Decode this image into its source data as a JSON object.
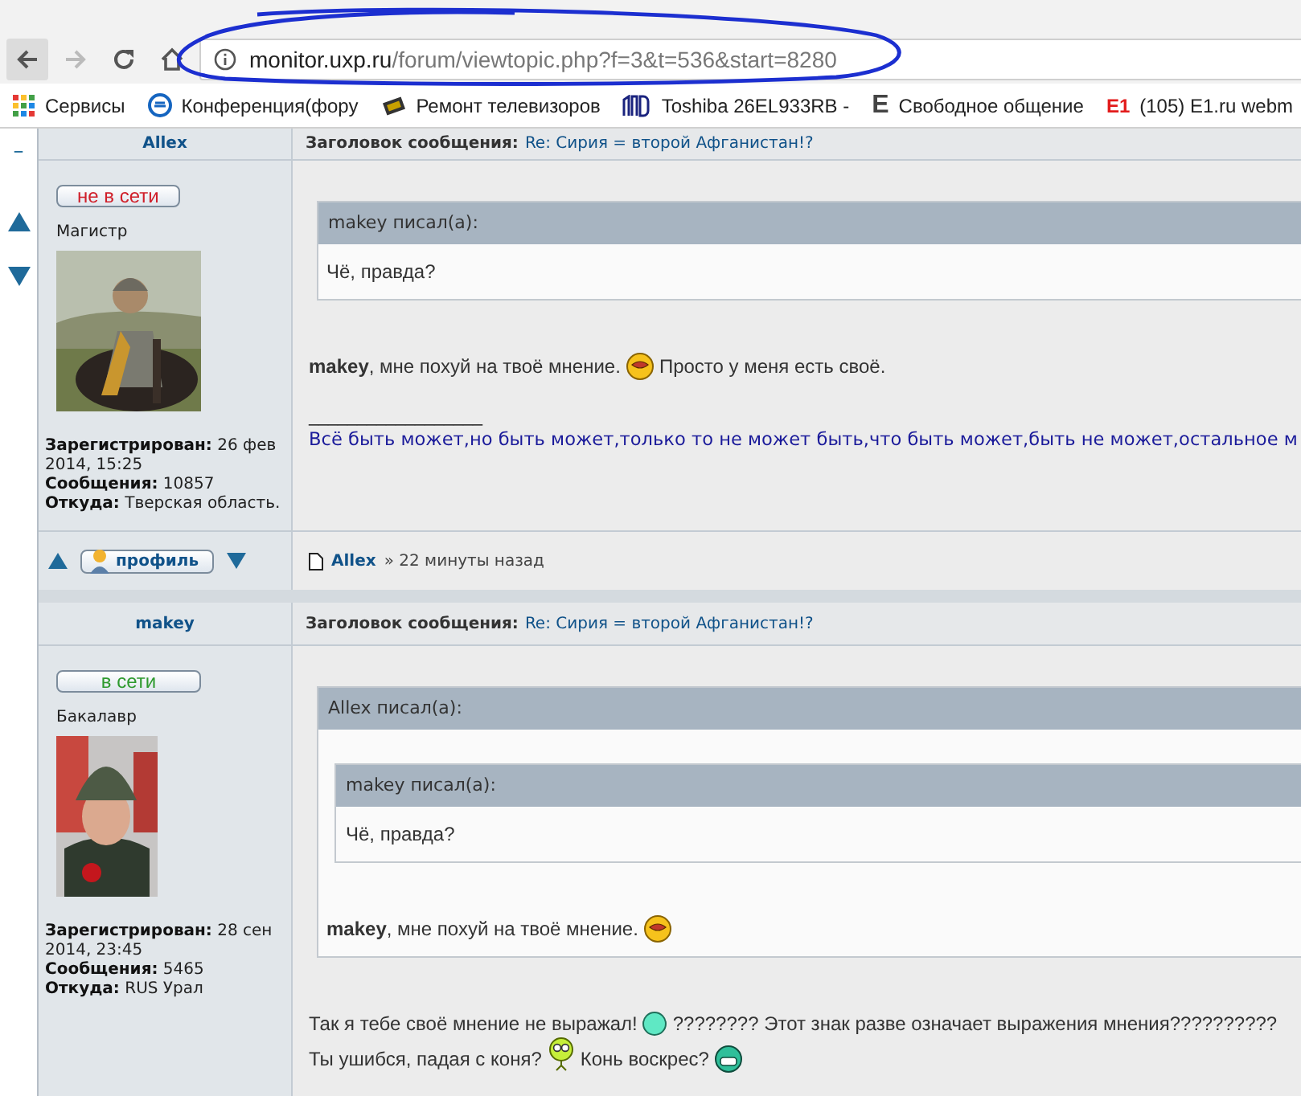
{
  "browser": {
    "url_host": "monitor.uxp.ru",
    "url_path": "/forum/viewtopic.php?f=3&t=536&start=8280",
    "bookmarks": [
      {
        "kind": "apps",
        "label": "Сервисы"
      },
      {
        "kind": "ie",
        "label": "Конференция(фору"
      },
      {
        "kind": "chip",
        "label": "Ремонт телевизоров"
      },
      {
        "kind": "aod",
        "label": "Toshiba 26EL933RB -"
      },
      {
        "kind": "letter",
        "badge": "E",
        "label": "Свободное общение"
      },
      {
        "kind": "e1",
        "badge": "E1",
        "label": "(105) E1.ru webm"
      }
    ]
  },
  "collapse": "–",
  "posts": [
    {
      "author": "Allex",
      "status": {
        "label": "не в сети",
        "online": false
      },
      "rank": "Магистр",
      "avatar": {
        "kind": "picture"
      },
      "details": [
        {
          "label": "Зарегистрирован:",
          "value": "26 фев 2014, 15:25"
        },
        {
          "label": "Сообщения:",
          "value": "10857"
        },
        {
          "label": "Откуда:",
          "value": "Тверская область."
        }
      ],
      "profile_button": "профиль",
      "subject_label": "Заголовок сообщения:",
      "subject": "Re: Сирия = второй Афганистан!?",
      "content": [
        {
          "kind": "quote",
          "header": "makey писал(а):",
          "content": [
            {
              "kind": "paragraph",
              "parts": [
                {
                  "kind": "text",
                  "text": "Чё, правда?"
                }
              ]
            }
          ]
        },
        {
          "kind": "paragraph",
          "parts": [
            {
              "kind": "text",
              "text": "**makey**, мне похуй на твоё мнение."
            },
            {
              "kind": "mouth"
            },
            {
              "kind": "text",
              "text": "Просто у меня есть своё."
            }
          ]
        }
      ],
      "signature": {
        "rule": "__________________",
        "text": "Всё быть может,но быть может,только то не может быть,что быть может,быть не может,остальное м"
      },
      "footer": {
        "author": "Allex",
        "time": "» 22 минуты назад"
      }
    },
    {
      "author": "makey",
      "status": {
        "label": "в сети",
        "online": true
      },
      "rank": "Бакалавр",
      "avatar": {
        "kind": "picture"
      },
      "details": [
        {
          "label": "Зарегистрирован:",
          "value": "28 сен 2014, 23:45"
        },
        {
          "label": "Сообщения:",
          "value": "5465"
        },
        {
          "label": "Откуда:",
          "value": "RUS Урал"
        }
      ],
      "subject_label": "Заголовок сообщения:",
      "subject": "Re: Сирия = второй Афганистан!?",
      "content": [
        {
          "kind": "quote",
          "header": "Allex писал(а):",
          "content": [
            {
              "kind": "quote",
              "header": "makey писал(а):",
              "content": [
                {
                  "kind": "paragraph",
                  "parts": [
                    {
                      "kind": "text",
                      "text": "Чё, правда?"
                    }
                  ]
                }
              ]
            },
            {
              "kind": "paragraph",
              "parts": [
                {
                  "kind": "text",
                  "text": "**makey**, мне похуй на твоё мнение."
                },
                {
                  "kind": "mouth"
                }
              ]
            }
          ]
        },
        {
          "kind": "paragraph",
          "parts": [
            {
              "kind": "text",
              "text": "Так я тебе своё мнение не выражал!"
            },
            {
              "kind": "circle"
            },
            {
              "kind": "text",
              "text": "???????? Этот знак разве означает выражения мнения??????????"
            }
          ]
        },
        {
          "kind": "paragraph",
          "parts": [
            {
              "kind": "text",
              "text": "Ты ушибся, падая с коня?"
            },
            {
              "kind": "goggles"
            },
            {
              "kind": "text",
              "text": "Конь воскрес?"
            },
            {
              "kind": "grin"
            }
          ]
        }
      ]
    }
  ]
}
